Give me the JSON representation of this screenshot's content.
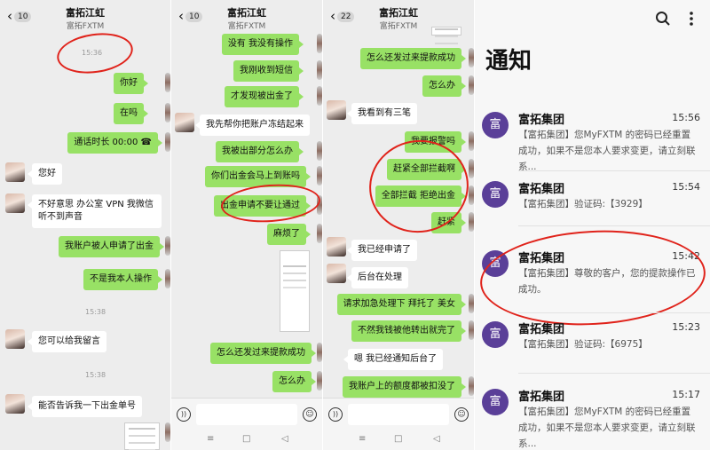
{
  "chat1": {
    "back_count": "10",
    "title": "富拓江虹",
    "subtitle": "富拓FXTM",
    "times": [
      "15:36",
      "15:38",
      "15:38"
    ],
    "msg_nihao": "你好",
    "msg_zaima": "在吗",
    "msg_call": "通话时长 00:00",
    "msg_reply_nihao": "您好",
    "msg_sorry": "不好意思 办公室 VPN 我微信听不到声音",
    "msg_blocked": "我账户被人申请了出金",
    "msg_notme": "不是我本人操作",
    "msg_leave": "您可以给我留言",
    "msg_order": "能否告诉我一下出金单号"
  },
  "chat2": {
    "back_count": "10",
    "title": "富拓江虹",
    "subtitle": "富拓FXTM",
    "msg_noop": "没有 我没有操作",
    "msg_sms": "我刚收到短信",
    "msg_found": "才发现被出金了",
    "msg_freeze": "我先帮你把账户冻结起来",
    "msg_how": "我被出部分怎么办",
    "msg_arrive": "你们出金会马上到账吗",
    "msg_nopass": "出金申请不要让通过",
    "msg_trouble": "麻烦了",
    "msg_how_come": "怎么还发过来提款成功",
    "msg_what": "怎么办"
  },
  "chat3": {
    "back_count": "22",
    "title": "富拓江虹",
    "subtitle": "富拓FXTM",
    "msg_how_come": "怎么还发过来提款成功",
    "msg_what": "怎么办",
    "msg_three": "我看到有三笔",
    "msg_police": "我要报警吗",
    "msg_intercept_all": "赶紧全部拦截啊",
    "msg_reject": "全部拦截 拒绝出金",
    "msg_hurry": "赶紧",
    "msg_applied": "我已经申请了",
    "msg_processing": "后台在处理",
    "msg_urgent": "请求加急处理下 拜托了 美女",
    "msg_transfer": "不然我钱被他转出就完了",
    "msg_notified": "嗯 我已经通知后台了",
    "msg_deducted": "我账户上的额度都被扣没了"
  },
  "notify": {
    "title": "通知",
    "search_icon": "search-icon",
    "menu_icon": "more-vert-icon",
    "items": [
      {
        "avatar": "富",
        "name": "富拓集团",
        "time": "15:56",
        "msg": "【富拓集团】您MyFXTM 的密码已经重置成功，如果不是您本人要求变更，请立刻联系..."
      },
      {
        "avatar": "富",
        "name": "富拓集团",
        "time": "15:54",
        "msg": "【富拓集团】验证码:【3929】"
      },
      {
        "avatar": "富",
        "name": "富拓集团",
        "time": "15:42",
        "msg": "【富拓集团】尊敬的客户，您的提款操作已成功。"
      },
      {
        "avatar": "富",
        "name": "富拓集团",
        "time": "15:23",
        "msg": "【富拓集团】验证码:【6975】"
      },
      {
        "avatar": "富",
        "name": "富拓集团",
        "time": "15:17",
        "msg": "【富拓集团】您MyFXTM 的密码已经重置成功，如果不是您本人要求变更，请立刻联系..."
      }
    ]
  },
  "colors": {
    "accent_green": "#98e165",
    "annotation_red": "#e0231b",
    "brand_purple": "#5a3f98"
  }
}
